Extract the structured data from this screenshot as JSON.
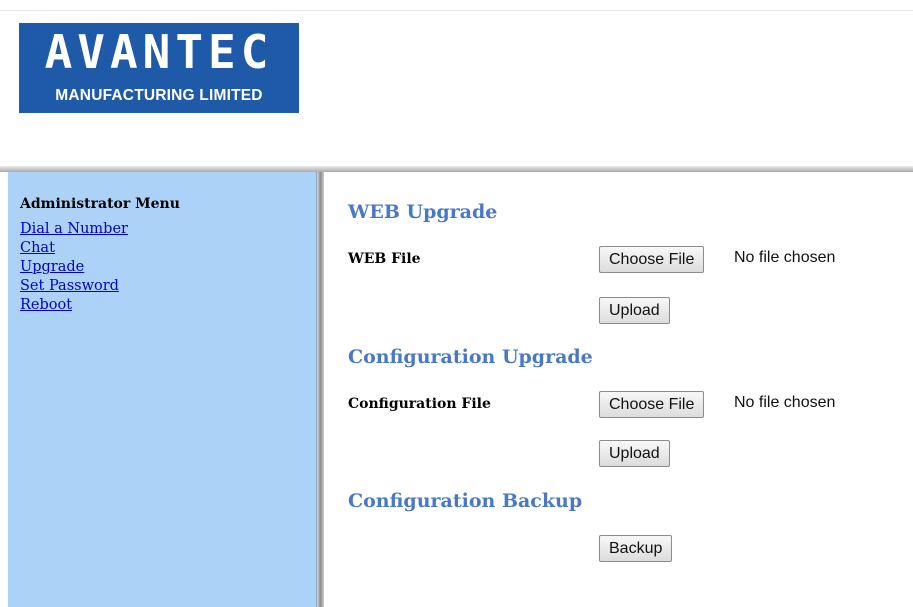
{
  "logo": {
    "brand": "AVANTEC",
    "subtitle": "MANUFACTURING LIMITED"
  },
  "sidebar": {
    "title": "Administrator Menu",
    "items": [
      {
        "label": "Dial a Number"
      },
      {
        "label": "Chat"
      },
      {
        "label": "Upgrade"
      },
      {
        "label": "Set Password"
      },
      {
        "label": "Reboot"
      }
    ]
  },
  "main": {
    "web_upgrade": {
      "title": "WEB Upgrade",
      "field_label": "WEB File",
      "choose_label": "Choose File",
      "status": "No file chosen",
      "upload_label": "Upload"
    },
    "config_upgrade": {
      "title": "Configuration Upgrade",
      "field_label": "Configuration File",
      "choose_label": "Choose File",
      "status": "No file chosen",
      "upload_label": "Upload"
    },
    "config_backup": {
      "title": "Configuration Backup",
      "backup_label": "Backup"
    }
  },
  "colors": {
    "sidebar_bg": "#add2f8",
    "section_title": "#4a78c7",
    "link": "#0000cc",
    "logo_bg": "#1e5aa8"
  }
}
